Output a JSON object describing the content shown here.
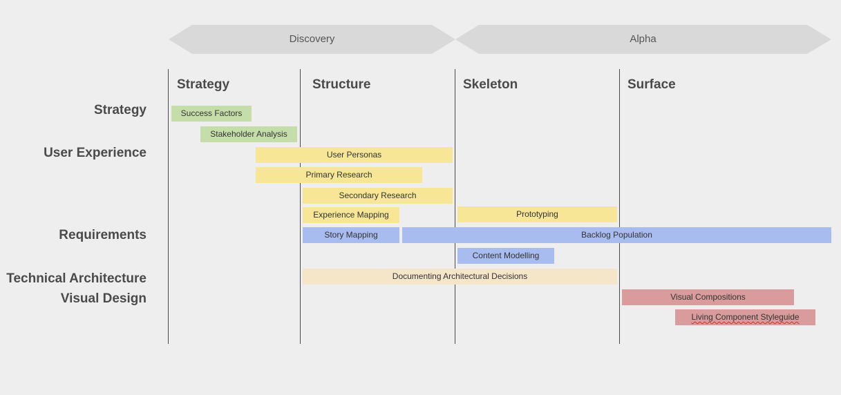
{
  "phases": [
    {
      "label": "Discovery"
    },
    {
      "label": "Alpha"
    }
  ],
  "columns": [
    "Strategy",
    "Structure",
    "Skeleton",
    "Surface"
  ],
  "rows": [
    "Strategy",
    "User Experience",
    "Requirements",
    "Technical Architecture",
    "Visual Design"
  ],
  "tasks": [
    {
      "label": "Success Factors",
      "category": "strategy"
    },
    {
      "label": "Stakeholder Analysis",
      "category": "strategy"
    },
    {
      "label": "User Personas",
      "category": "ux"
    },
    {
      "label": "Primary Research",
      "category": "ux"
    },
    {
      "label": "Secondary Research",
      "category": "ux"
    },
    {
      "label": "Experience Mapping",
      "category": "ux"
    },
    {
      "label": "Prototyping",
      "category": "ux"
    },
    {
      "label": "Story Mapping",
      "category": "requirements"
    },
    {
      "label": "Backlog Population",
      "category": "requirements"
    },
    {
      "label": "Content Modelling",
      "category": "requirements"
    },
    {
      "label": "Documenting Architectural Decisions",
      "category": "architecture"
    },
    {
      "label": "Visual Compositions",
      "category": "design"
    },
    {
      "label": "Living Component Styleguide",
      "category": "design"
    }
  ],
  "colors": {
    "strategy": "#c5dea9",
    "ux": "#f6e695",
    "requirements": "#a9bcef",
    "architecture": "#f5e5c9",
    "design": "#d99b9b",
    "phase_arrow": "#d9d9d9",
    "text": "#4a4a4a"
  }
}
